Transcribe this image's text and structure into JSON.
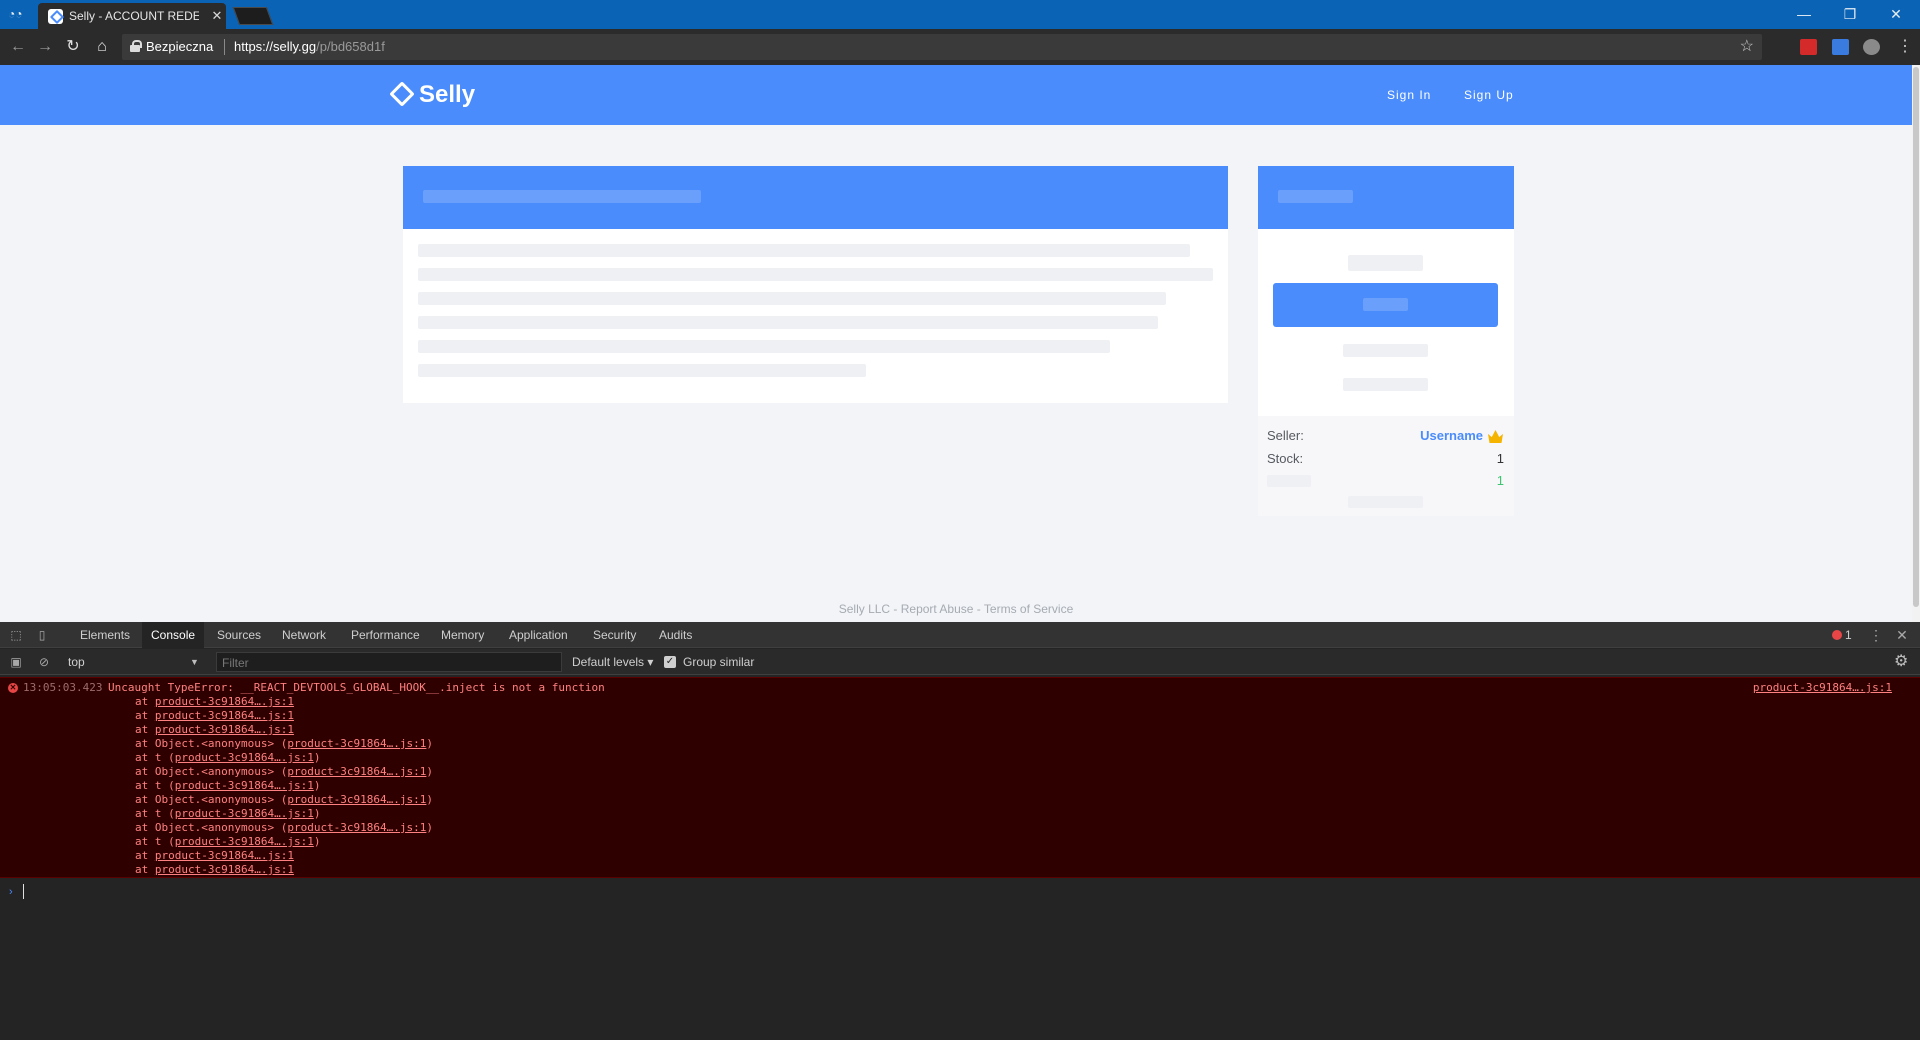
{
  "browser": {
    "tab_title": "Selly - ACCOUNT REDEYE",
    "secure_label": "Bezpieczna",
    "url_host": "https://selly.gg",
    "url_path": "/p/bd658d1f"
  },
  "site": {
    "logo_text": "Selly",
    "sign_in": "Sign In",
    "sign_up": "Sign Up",
    "accent_color": "#4a8cfb"
  },
  "product_info": {
    "seller_label": "Seller:",
    "seller_value": "Username",
    "stock_label": "Stock:",
    "stock_value": "1",
    "extra_value": "1"
  },
  "footer": {
    "text": "Selly LLC - Report Abuse - Terms of Service"
  },
  "devtools": {
    "tabs": [
      "Elements",
      "Console",
      "Sources",
      "Network",
      "Performance",
      "Memory",
      "Application",
      "Security",
      "Audits"
    ],
    "selected_tab": "Console",
    "error_count": "1",
    "context": "top",
    "filter_placeholder": "Filter",
    "levels": "Default levels",
    "group_similar": "Group similar",
    "error": {
      "time": "13:05:03.423",
      "message": "Uncaught TypeError: __REACT_DEVTOOLS_GLOBAL_HOOK__.inject is not a function",
      "source": "product-3c91864….js:1"
    },
    "stack": [
      {
        "prefix": "at ",
        "link": "product-3c91864….js:1",
        "suffix": ""
      },
      {
        "prefix": "at ",
        "link": "product-3c91864….js:1",
        "suffix": ""
      },
      {
        "prefix": "at ",
        "link": "product-3c91864….js:1",
        "suffix": ""
      },
      {
        "prefix": "at Object.<anonymous> (",
        "link": "product-3c91864….js:1",
        "suffix": ")"
      },
      {
        "prefix": "at t (",
        "link": "product-3c91864….js:1",
        "suffix": ")"
      },
      {
        "prefix": "at Object.<anonymous> (",
        "link": "product-3c91864….js:1",
        "suffix": ")"
      },
      {
        "prefix": "at t (",
        "link": "product-3c91864….js:1",
        "suffix": ")"
      },
      {
        "prefix": "at Object.<anonymous> (",
        "link": "product-3c91864….js:1",
        "suffix": ")"
      },
      {
        "prefix": "at t (",
        "link": "product-3c91864….js:1",
        "suffix": ")"
      },
      {
        "prefix": "at Object.<anonymous> (",
        "link": "product-3c91864….js:1",
        "suffix": ")"
      },
      {
        "prefix": "at t (",
        "link": "product-3c91864….js:1",
        "suffix": ")"
      },
      {
        "prefix": "at ",
        "link": "product-3c91864….js:1",
        "suffix": ""
      },
      {
        "prefix": "at ",
        "link": "product-3c91864….js:1",
        "suffix": ""
      }
    ]
  }
}
